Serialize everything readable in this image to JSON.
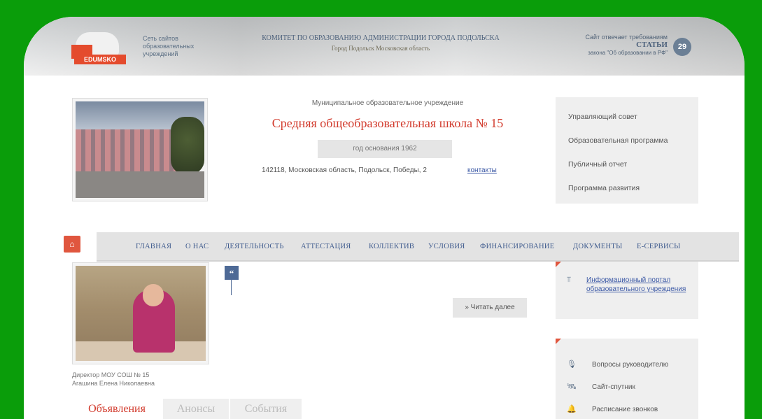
{
  "header": {
    "logo_text": "EDUMSKO",
    "network_text": "Сеть сайтов образовательных учреждений",
    "committee_title": "КОМИТЕТ ПО ОБРАЗОВАНИЮ АДМИНИСТРАЦИИ ГОРОДА ПОДОЛЬСКА",
    "committee_subtitle": "Город Подольск Московская область",
    "law_line1": "Сайт отвечает требованиям",
    "law_line2": "СТАТЬИ",
    "law_line3": "закона \"Об образовании в РФ\"",
    "law_badge": "29"
  },
  "school": {
    "institution_type": "Муниципальное образовательное учреждение",
    "name": "Средняя общеобразовательная школа № 15",
    "founded": "год основания 1962",
    "address": "142118, Московская область, Подольск, Победы, 2",
    "contacts_link": "контакты"
  },
  "quick_links": [
    "Управляющий совет",
    "Образовательная программа",
    "Публичный отчет",
    "Программа развития"
  ],
  "nav": {
    "home_icon": "home-icon",
    "items": [
      "ГЛАВНАЯ",
      "О НАС",
      "ДЕЯТЕЛЬНОСТЬ",
      "АТТЕСТАЦИЯ",
      "КОЛЛЕКТИВ",
      "УСЛОВИЯ",
      "ФИНАНСИРОВАНИЕ",
      "ДОКУМЕНТЫ",
      "Е-СЕРВИСЫ"
    ]
  },
  "director": {
    "caption_line1": "Директор МОУ СОШ № 15",
    "caption_line2": "Агашина Елена Николаевна"
  },
  "quote": {
    "icon": "“",
    "read_more": "» Читать далее"
  },
  "portal": {
    "icon": "portal-icon",
    "link": "Информационный портал образовательного учреждения"
  },
  "side_links": [
    {
      "icon": "microphone-icon",
      "label": "Вопросы руководителю"
    },
    {
      "icon": "satellite-icon",
      "label": "Сайт-спутник"
    },
    {
      "icon": "bell-icon",
      "label": "Расписание звонков"
    }
  ],
  "tabs": [
    "Объявления",
    "Анонсы",
    "События"
  ],
  "colors": {
    "background": "#0a9d0a",
    "accent_red": "#d23a2c",
    "nav_text": "#3f5b8e",
    "link_blue": "#3b58a5"
  }
}
